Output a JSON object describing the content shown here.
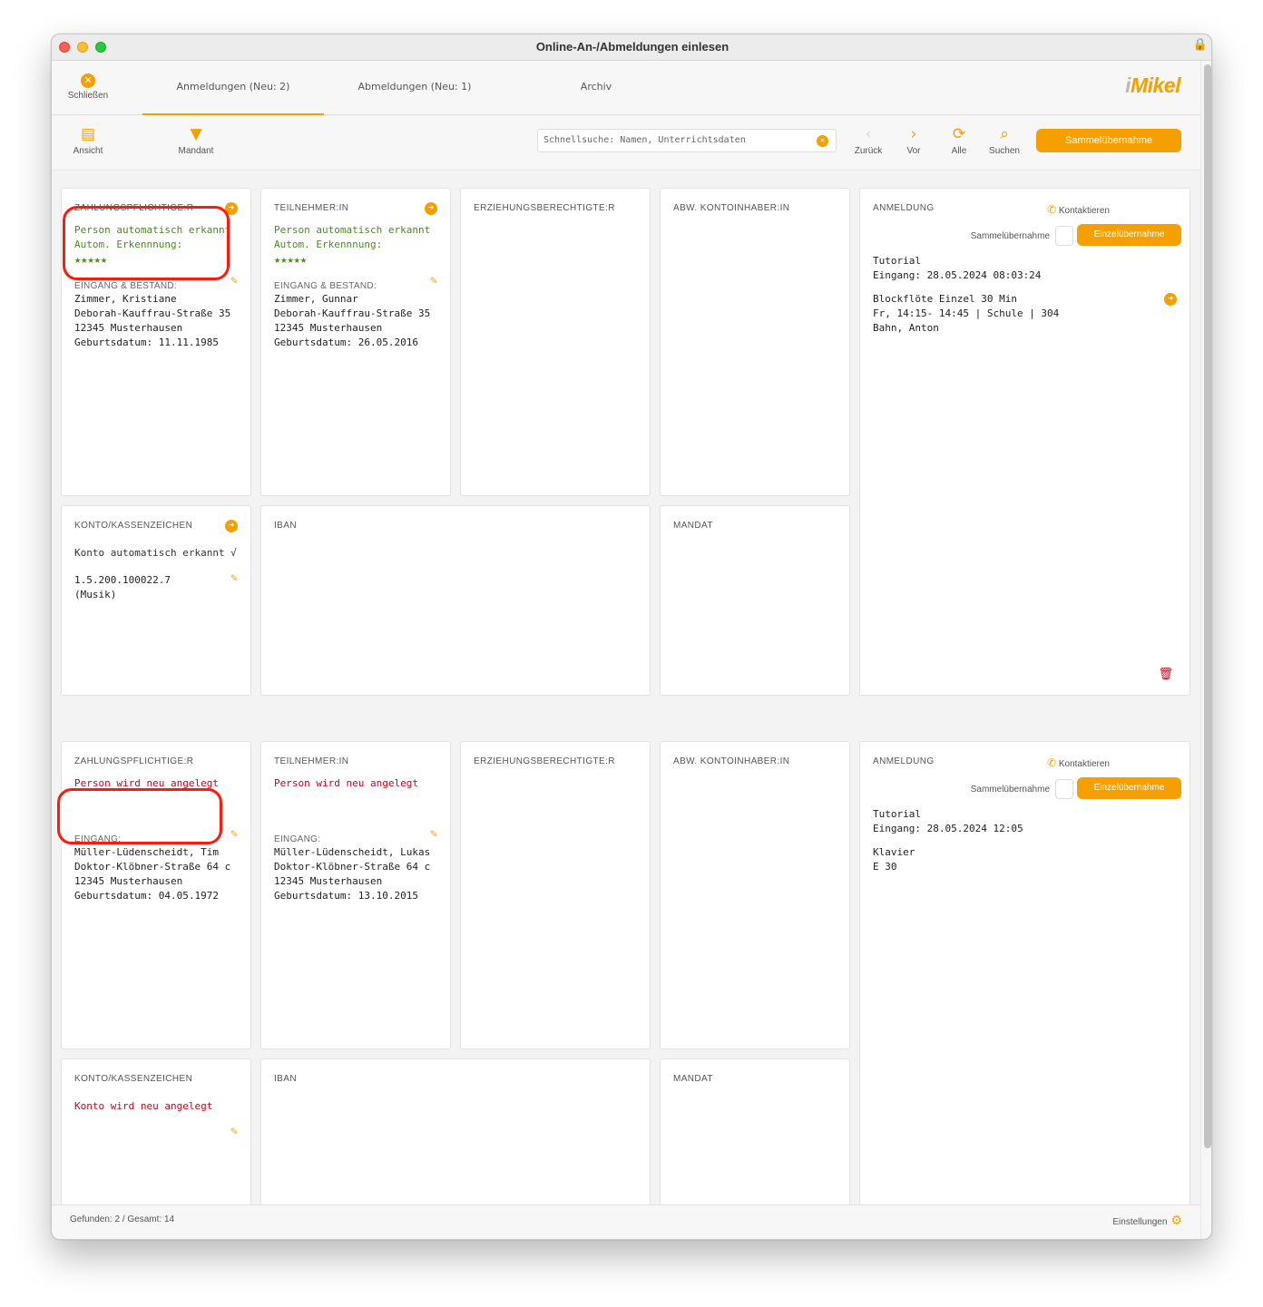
{
  "window": {
    "title": "Online-An-/Abmeldungen einlesen"
  },
  "toolbar": {
    "close_label": "Schließen",
    "tabs": [
      {
        "label": "Anmeldungen (Neu: 2)",
        "active": true
      },
      {
        "label": "Abmeldungen (Neu: 1)",
        "active": false
      },
      {
        "label": "Archiv",
        "active": false
      }
    ],
    "logo": {
      "prefix": "i",
      "rest": "Mikel"
    }
  },
  "toolbar2": {
    "ansicht_label": "Ansicht",
    "mandant_label": "Mandant",
    "search_placeholder": "Schnellsuche: Namen, Unterrichtsdaten",
    "back_label": "Zurück",
    "forward_label": "Vor",
    "all_label": "Alle",
    "search_label": "Suchen",
    "sammel_label": "Sammelübernahme"
  },
  "records": [
    {
      "payer": {
        "header": "ZAHLUNGSPFLICHTIGE:R",
        "status_line1": "Person automatisch erkannt",
        "status_line2": "Autom. Erkennnung:",
        "stars": "★★★★★",
        "section": "EINGANG & BESTAND:",
        "lines": "Zimmer, Kristiane\nDeborah-Kauffrau-Straße 35\n12345 Musterhausen\nGeburtsdatum: 11.11.1985"
      },
      "participant": {
        "header": "TEILNEHMER:IN",
        "status_line1": "Person automatisch erkannt",
        "status_line2": "Autom. Erkennnung:",
        "stars": "★★★★★",
        "section": "EINGANG & BESTAND:",
        "lines": "Zimmer, Gunnar\nDeborah-Kauffrau-Straße 35\n12345 Musterhausen\nGeburtsdatum: 26.05.2016"
      },
      "guardian_header": "ERZIEHUNGSBERECHTIGTE:R",
      "account_holder_header": "ABW. KONTOINHABER:IN",
      "registration": {
        "header": "ANMELDUNG",
        "contact": "Kontaktieren",
        "sammel": "Sammelübernahme",
        "einzel": "Einzelübernahme",
        "entry": "Tutorial\nEingang: 28.05.2024 08:03:24",
        "course": "Blockflöte Einzel 30 Min\nFr, 14:15- 14:45 | Schule | 304\nBahn, Anton"
      },
      "account": {
        "header": "KONTO/KASSENZEICHEN",
        "status": "Konto automatisch erkannt √",
        "lines": "1.5.200.100022.7\n(Musik)"
      },
      "iban_header": "IBAN",
      "mandate_header": "MANDAT"
    },
    {
      "payer": {
        "header": "ZAHLUNGSPFLICHTIGE:R",
        "status_line1": "Person wird neu angelegt",
        "section": "EINGANG:",
        "lines": "Müller-Lüdenscheidt, Tim\nDoktor-Klöbner-Straße 64 c\n12345 Musterhausen\nGeburtsdatum: 04.05.1972"
      },
      "participant": {
        "header": "TEILNEHMER:IN",
        "status_line1": "Person wird neu angelegt",
        "section": "EINGANG:",
        "lines": "Müller-Lüdenscheidt, Lukas\nDoktor-Klöbner-Straße 64 c\n12345 Musterhausen\nGeburtsdatum: 13.10.2015"
      },
      "guardian_header": "ERZIEHUNGSBERECHTIGTE:R",
      "account_holder_header": "ABW. KONTOINHABER:IN",
      "registration": {
        "header": "ANMELDUNG",
        "contact": "Kontaktieren",
        "sammel": "Sammelübernahme",
        "einzel": "Einzelübernahme",
        "entry": "Tutorial\nEingang: 28.05.2024 12:05",
        "course": "Klavier\nE 30"
      },
      "account": {
        "header": "KONTO/KASSENZEICHEN",
        "status": "Konto wird neu angelegt"
      },
      "iban_header": "IBAN",
      "mandate_header": "MANDAT"
    }
  ],
  "statusbar": {
    "found": "Gefunden: 2 / Gesamt: 14",
    "settings": "Einstellungen"
  },
  "colors": {
    "accent": "#f5a000",
    "recognized": "#4a8a22",
    "new": "#d0021b",
    "annotation": "#ff1a0a"
  }
}
